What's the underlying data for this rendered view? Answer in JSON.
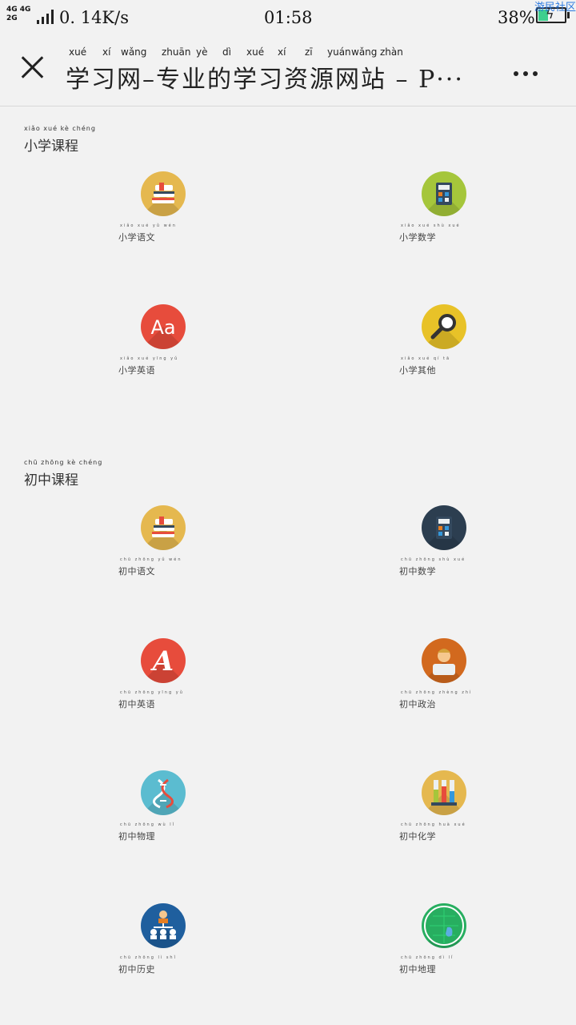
{
  "status_bar": {
    "network_top": "4G 4G",
    "network_bottom": "2G",
    "speed": "0. 14K/s",
    "time": "01:58",
    "battery": "38%",
    "battery_level_percent": 38,
    "corner_tag": "游民社区"
  },
  "header": {
    "pinyin": [
      "xué",
      "xí",
      "wǎng",
      "zhuān",
      "yè",
      "dì",
      "xué",
      "xí",
      "zī",
      "yuán",
      "wǎng",
      "zhàn"
    ],
    "title": "学习网–专业的学习资源网站 – P···"
  },
  "sections": [
    {
      "pinyin": "xiǎo  xué  kè  chéng",
      "title": "小学课程",
      "items": [
        {
          "pinyin": "xiǎo xué yǔ wén",
          "label": "小学语文",
          "icon": "books-icon",
          "color": "#e5b84f"
        },
        {
          "pinyin": "xiǎo xué shù xué",
          "label": "小学数学",
          "icon": "calculator-icon",
          "color": "#a5c63b"
        },
        {
          "pinyin": "xiǎo xué yīng yǔ",
          "label": "小学英语",
          "icon": "aa-letters-icon",
          "color": "#e74c3c"
        },
        {
          "pinyin": "xiǎo xué qí tā",
          "label": "小学其他",
          "icon": "magnifier-icon",
          "color": "#e8c228"
        }
      ]
    },
    {
      "pinyin": "chū  zhōng  kè  chéng",
      "title": "初中课程",
      "items": [
        {
          "pinyin": "chū zhōng yǔ wén",
          "label": "初中语文",
          "icon": "books-icon",
          "color": "#e5b84f"
        },
        {
          "pinyin": "chū zhōng shù xué",
          "label": "初中数学",
          "icon": "calculator-icon",
          "color": "#2c3e50"
        },
        {
          "pinyin": "chū zhōng yīng yǔ",
          "label": "初中英语",
          "icon": "letter-a-icon",
          "color": "#e74c3c"
        },
        {
          "pinyin": "chū zhōng zhèng zhì",
          "label": "初中政治",
          "icon": "person-icon",
          "color": "#d2691e"
        },
        {
          "pinyin": "chū zhōng wù lǐ",
          "label": "初中物理",
          "icon": "dna-icon",
          "color": "#5bbcd0"
        },
        {
          "pinyin": "chū zhōng huà xué",
          "label": "初中化学",
          "icon": "test-tubes-icon",
          "color": "#e5b84f"
        },
        {
          "pinyin": "chū zhōng lì shǐ",
          "label": "初中历史",
          "icon": "org-chart-icon",
          "color": "#1f5f9e"
        },
        {
          "pinyin": "chū zhōng dì lǐ",
          "label": "初中地理",
          "icon": "globe-icon",
          "color": "#27ae60"
        }
      ]
    }
  ]
}
